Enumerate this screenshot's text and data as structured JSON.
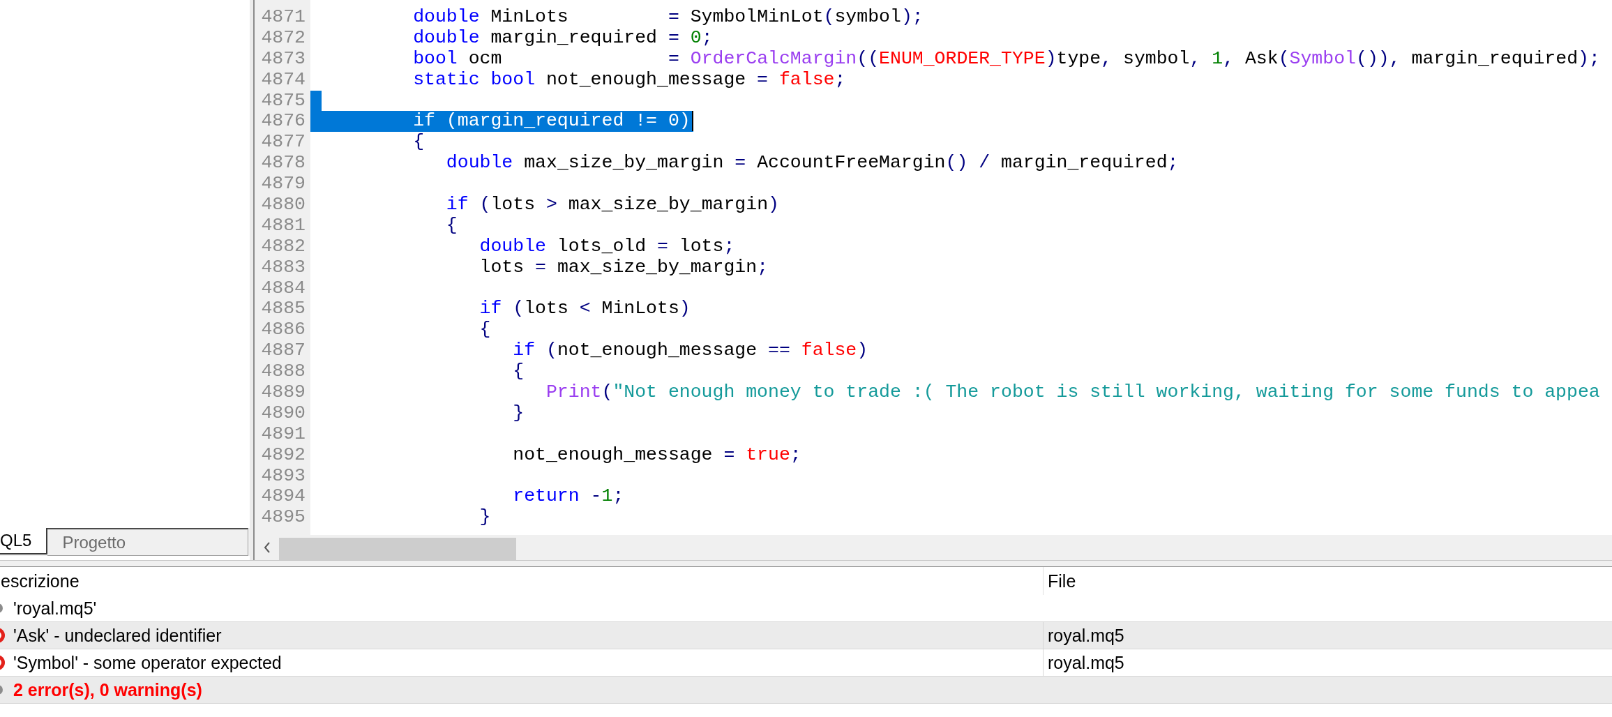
{
  "sidebar": {
    "tabs": [
      {
        "label": "QL5",
        "selected": true
      },
      {
        "label": "Progetto",
        "selected": false
      }
    ]
  },
  "editor": {
    "lines": [
      {
        "number": "4871",
        "selected": false,
        "caret": false,
        "tokens": [
          {
            "kind": "keyword",
            "text": "         double"
          },
          {
            "kind": "identifier",
            "text": " MinLots"
          },
          {
            "kind": "operator",
            "text": "         ="
          },
          {
            "kind": "identifier",
            "text": " SymbolMinLot"
          },
          {
            "kind": "operator",
            "text": "("
          },
          {
            "kind": "identifier",
            "text": "symbol"
          },
          {
            "kind": "operator",
            "text": ");"
          }
        ]
      },
      {
        "number": "4872",
        "selected": false,
        "caret": false,
        "tokens": [
          {
            "kind": "keyword",
            "text": "         double"
          },
          {
            "kind": "identifier",
            "text": " margin_required"
          },
          {
            "kind": "operator",
            "text": " ="
          },
          {
            "kind": "number",
            "text": " 0"
          },
          {
            "kind": "operator",
            "text": ";"
          }
        ]
      },
      {
        "number": "4873",
        "selected": false,
        "caret": false,
        "tokens": [
          {
            "kind": "keyword",
            "text": "         bool"
          },
          {
            "kind": "identifier",
            "text": " ocm"
          },
          {
            "kind": "operator",
            "text": "               ="
          },
          {
            "kind": "builtin",
            "text": " OrderCalcMargin"
          },
          {
            "kind": "operator",
            "text": "(("
          },
          {
            "kind": "constant",
            "text": "ENUM_ORDER_TYPE"
          },
          {
            "kind": "operator",
            "text": ")"
          },
          {
            "kind": "identifier",
            "text": "type"
          },
          {
            "kind": "operator",
            "text": ","
          },
          {
            "kind": "identifier",
            "text": " symbol"
          },
          {
            "kind": "operator",
            "text": ","
          },
          {
            "kind": "number",
            "text": " 1"
          },
          {
            "kind": "operator",
            "text": ","
          },
          {
            "kind": "identifier",
            "text": " Ask"
          },
          {
            "kind": "operator",
            "text": "("
          },
          {
            "kind": "builtin",
            "text": "Symbol"
          },
          {
            "kind": "operator",
            "text": "()),"
          },
          {
            "kind": "identifier",
            "text": " margin_required"
          },
          {
            "kind": "operator",
            "text": ");"
          }
        ]
      },
      {
        "number": "4874",
        "selected": false,
        "caret": false,
        "tokens": [
          {
            "kind": "keyword",
            "text": "         static"
          },
          {
            "kind": "keyword",
            "text": " bool"
          },
          {
            "kind": "identifier",
            "text": " not_enough_message"
          },
          {
            "kind": "operator",
            "text": " ="
          },
          {
            "kind": "constant",
            "text": " false"
          },
          {
            "kind": "operator",
            "text": ";"
          }
        ]
      },
      {
        "number": "4875",
        "selected": true,
        "caret": false
      },
      {
        "number": "4876",
        "selected": true,
        "caret": true,
        "tokens": [
          {
            "kind": "keyword",
            "text": "         if"
          },
          {
            "kind": "operator",
            "text": " ("
          },
          {
            "kind": "identifier",
            "text": "margin_required"
          },
          {
            "kind": "operator",
            "text": " !="
          },
          {
            "kind": "number",
            "text": " 0"
          },
          {
            "kind": "operator",
            "text": ")"
          }
        ]
      },
      {
        "number": "4877",
        "selected": false,
        "caret": false,
        "tokens": [
          {
            "kind": "operator",
            "text": "         {"
          }
        ]
      },
      {
        "number": "4878",
        "selected": false,
        "caret": false,
        "tokens": [
          {
            "kind": "keyword",
            "text": "            double"
          },
          {
            "kind": "identifier",
            "text": " max_size_by_margin"
          },
          {
            "kind": "operator",
            "text": " ="
          },
          {
            "kind": "identifier",
            "text": " AccountFreeMargin"
          },
          {
            "kind": "operator",
            "text": "()"
          },
          {
            "kind": "operator",
            "text": " /"
          },
          {
            "kind": "identifier",
            "text": " margin_required"
          },
          {
            "kind": "operator",
            "text": ";"
          }
        ]
      },
      {
        "number": "4879",
        "selected": false,
        "caret": false
      },
      {
        "number": "4880",
        "selected": false,
        "caret": false,
        "tokens": [
          {
            "kind": "keyword",
            "text": "            if"
          },
          {
            "kind": "operator",
            "text": " ("
          },
          {
            "kind": "identifier",
            "text": "lots"
          },
          {
            "kind": "operator",
            "text": " >"
          },
          {
            "kind": "identifier",
            "text": " max_size_by_margin"
          },
          {
            "kind": "operator",
            "text": ")"
          }
        ]
      },
      {
        "number": "4881",
        "selected": false,
        "caret": false,
        "tokens": [
          {
            "kind": "operator",
            "text": "            {"
          }
        ]
      },
      {
        "number": "4882",
        "selected": false,
        "caret": false,
        "tokens": [
          {
            "kind": "keyword",
            "text": "               double"
          },
          {
            "kind": "identifier",
            "text": " lots_old"
          },
          {
            "kind": "operator",
            "text": " ="
          },
          {
            "kind": "identifier",
            "text": " lots"
          },
          {
            "kind": "operator",
            "text": ";"
          }
        ]
      },
      {
        "number": "4883",
        "selected": false,
        "caret": false,
        "tokens": [
          {
            "kind": "identifier",
            "text": "               lots"
          },
          {
            "kind": "operator",
            "text": " ="
          },
          {
            "kind": "identifier",
            "text": " max_size_by_margin"
          },
          {
            "kind": "operator",
            "text": ";"
          }
        ]
      },
      {
        "number": "4884",
        "selected": false,
        "caret": false
      },
      {
        "number": "4885",
        "selected": false,
        "caret": false,
        "tokens": [
          {
            "kind": "keyword",
            "text": "               if"
          },
          {
            "kind": "operator",
            "text": " ("
          },
          {
            "kind": "identifier",
            "text": "lots"
          },
          {
            "kind": "operator",
            "text": " <"
          },
          {
            "kind": "identifier",
            "text": " MinLots"
          },
          {
            "kind": "operator",
            "text": ")"
          }
        ]
      },
      {
        "number": "4886",
        "selected": false,
        "caret": false,
        "tokens": [
          {
            "kind": "operator",
            "text": "               {"
          }
        ]
      },
      {
        "number": "4887",
        "selected": false,
        "caret": false,
        "tokens": [
          {
            "kind": "keyword",
            "text": "                  if"
          },
          {
            "kind": "operator",
            "text": " ("
          },
          {
            "kind": "identifier",
            "text": "not_enough_message"
          },
          {
            "kind": "operator",
            "text": " =="
          },
          {
            "kind": "constant",
            "text": " false"
          },
          {
            "kind": "operator",
            "text": ")"
          }
        ]
      },
      {
        "number": "4888",
        "selected": false,
        "caret": false,
        "tokens": [
          {
            "kind": "operator",
            "text": "                  {"
          }
        ]
      },
      {
        "number": "4889",
        "selected": false,
        "caret": false,
        "tokens": [
          {
            "kind": "builtin",
            "text": "                     Print"
          },
          {
            "kind": "operator",
            "text": "("
          },
          {
            "kind": "string",
            "text": "\"Not enough money to trade :( The robot is still working, waiting for some funds to appea"
          }
        ]
      },
      {
        "number": "4890",
        "selected": false,
        "caret": false,
        "tokens": [
          {
            "kind": "operator",
            "text": "                  }"
          }
        ]
      },
      {
        "number": "4891",
        "selected": false,
        "caret": false
      },
      {
        "number": "4892",
        "selected": false,
        "caret": false,
        "tokens": [
          {
            "kind": "identifier",
            "text": "                  not_enough_message"
          },
          {
            "kind": "operator",
            "text": " ="
          },
          {
            "kind": "constant",
            "text": " true"
          },
          {
            "kind": "operator",
            "text": ";"
          }
        ]
      },
      {
        "number": "4893",
        "selected": false,
        "caret": false
      },
      {
        "number": "4894",
        "selected": false,
        "caret": false,
        "tokens": [
          {
            "kind": "keyword",
            "text": "                  return"
          },
          {
            "kind": "operator",
            "text": " -"
          },
          {
            "kind": "number",
            "text": "1"
          },
          {
            "kind": "operator",
            "text": ";"
          }
        ]
      },
      {
        "number": "4895",
        "selected": false,
        "caret": false,
        "tokens": [
          {
            "kind": "operator",
            "text": "               }"
          }
        ]
      }
    ]
  },
  "messages": {
    "columns": [
      "escrizione",
      "File"
    ],
    "rows": [
      {
        "kind": "file",
        "description": "'royal.mq5'"
      },
      {
        "kind": "error",
        "description": "'Ask' - undeclared identifier",
        "file": "royal.mq5"
      },
      {
        "kind": "error",
        "description": "'Symbol' - some operator expected",
        "file": "royal.mq5"
      },
      {
        "kind": "summary",
        "description": "2 error(s), 0 warning(s)"
      }
    ]
  }
}
